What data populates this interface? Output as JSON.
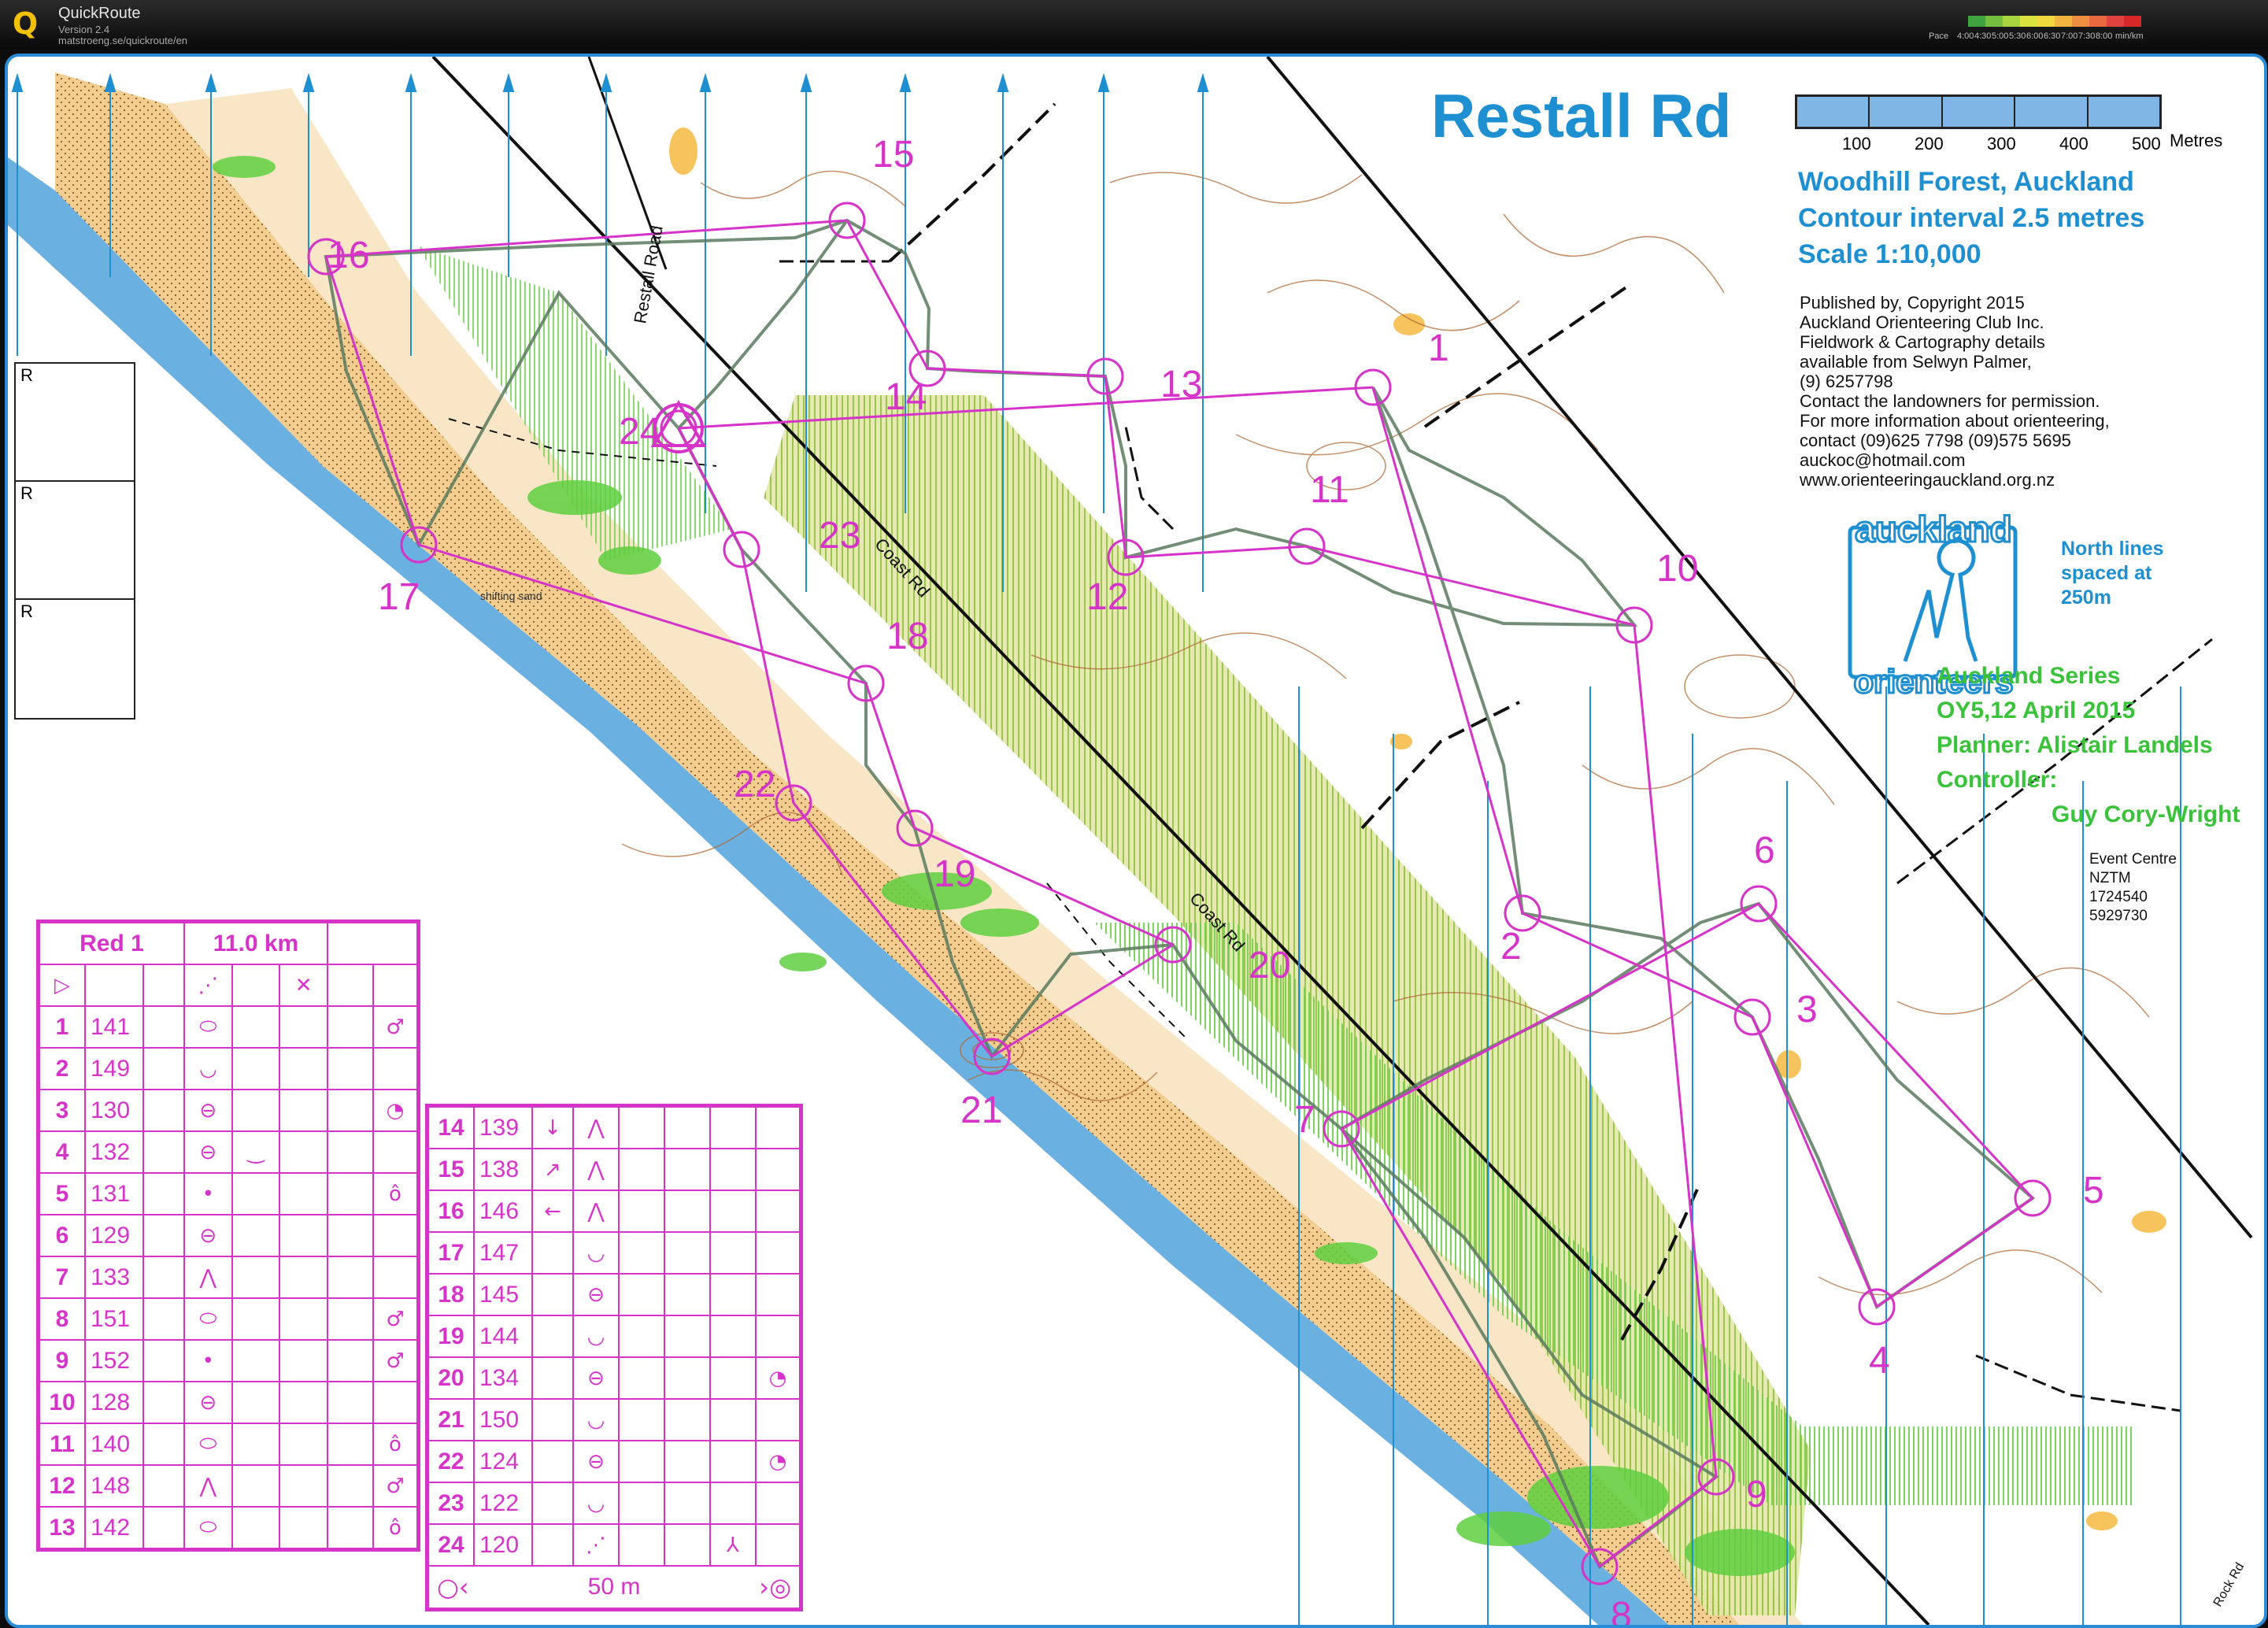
{
  "app": {
    "name": "QuickRoute",
    "version": "Version 2.4",
    "url": "matstroeng.se/quickroute/en",
    "pace_legend": {
      "title": "Pace",
      "unit": "min/km",
      "labels": [
        "4:00",
        "4:30",
        "5:00",
        "5:30",
        "6:00",
        "6:30",
        "7:00",
        "7:30",
        "8:00"
      ],
      "colors": [
        "#3fa33f",
        "#74bf3f",
        "#a7d43f",
        "#d9e23f",
        "#f2d83f",
        "#f2b53f",
        "#ee8f3f",
        "#e8693f",
        "#e0423f",
        "#d62828"
      ]
    }
  },
  "map": {
    "title": "Restall Rd",
    "scale_labels": [
      "100",
      "200",
      "300",
      "400",
      "500"
    ],
    "scale_unit": "Metres",
    "location": "Woodhill Forest, Auckland",
    "contour": "Contour interval 2.5 metres",
    "scale": "Scale 1:10,000",
    "credits": [
      "Published by, Copyright 2015",
      "Auckland Orienteering Club Inc.",
      "Fieldwork & Cartography details",
      "available from Selwyn Palmer,",
      "(9) 6257798",
      "Contact the landowners for permission.",
      "For more information about orienteering,",
      "contact (09)625 7798  (09)575 5695",
      "auckoc@hotmail.com",
      "www.orienteeringauckland.org.nz"
    ],
    "club_logo": [
      "auckland",
      "orienteers"
    ],
    "north_note": [
      "North lines",
      "spaced at",
      "250m"
    ],
    "series": [
      "Auckland Series",
      "OY5,12 April 2015",
      "Planner: Alistair Landels",
      "Controller:",
      "Guy Cory-Wright"
    ],
    "event": [
      "Event Centre",
      "NZTM",
      "1724540",
      "5929730"
    ],
    "road_labels": [
      "Restall Road",
      "Coast Rd",
      "Coast Rd",
      "shifting sand",
      "Rock Rd"
    ],
    "colors": {
      "course": "#d633c8",
      "route": "#5a7a5e",
      "sea": "#6ab0e0",
      "sand": "#f0c98a",
      "contour": "#a0522d",
      "felled": "#c8cf5a",
      "green": "#5fcf3f",
      "north": "#1e8fd0"
    }
  },
  "course": {
    "controls": [
      {
        "n": "1",
        "x": 1734,
        "y": 420
      },
      {
        "n": "2",
        "x": 1924,
        "y": 1088
      },
      {
        "n": "3",
        "x": 2216,
        "y": 1220
      },
      {
        "n": "4",
        "x": 2374,
        "y": 1588
      },
      {
        "n": "5",
        "x": 2572,
        "y": 1450
      },
      {
        "n": "6",
        "x": 2224,
        "y": 1076
      },
      {
        "n": "7",
        "x": 1694,
        "y": 1362
      },
      {
        "n": "8",
        "x": 2022,
        "y": 1918
      },
      {
        "n": "9",
        "x": 2170,
        "y": 1804
      },
      {
        "n": "10",
        "x": 2066,
        "y": 722
      },
      {
        "n": "11",
        "x": 1650,
        "y": 622
      },
      {
        "n": "12",
        "x": 1420,
        "y": 636
      },
      {
        "n": "13",
        "x": 1394,
        "y": 406
      },
      {
        "n": "14",
        "x": 1168,
        "y": 396
      },
      {
        "n": "15",
        "x": 1066,
        "y": 208
      },
      {
        "n": "16",
        "x": 404,
        "y": 254
      },
      {
        "n": "17",
        "x": 522,
        "y": 620
      },
      {
        "n": "18",
        "x": 1090,
        "y": 796
      },
      {
        "n": "19",
        "x": 1152,
        "y": 980
      },
      {
        "n": "20",
        "x": 1480,
        "y": 1128
      },
      {
        "n": "21",
        "x": 1250,
        "y": 1270
      },
      {
        "n": "22",
        "x": 998,
        "y": 948
      },
      {
        "n": "23",
        "x": 932,
        "y": 626
      },
      {
        "n": "24",
        "x": 852,
        "y": 472
      }
    ],
    "labels": [
      {
        "t": "1",
        "x": 1804,
        "y": 386
      },
      {
        "t": "2",
        "x": 1896,
        "y": 1146
      },
      {
        "t": "3",
        "x": 2272,
        "y": 1226
      },
      {
        "t": "4",
        "x": 2364,
        "y": 1672
      },
      {
        "t": "5",
        "x": 2636,
        "y": 1456
      },
      {
        "t": "6",
        "x": 2218,
        "y": 1024
      },
      {
        "t": "7",
        "x": 1634,
        "y": 1366
      },
      {
        "t": "8",
        "x": 2036,
        "y": 1996
      },
      {
        "t": "9",
        "x": 2208,
        "y": 1842
      },
      {
        "t": "10",
        "x": 2094,
        "y": 666
      },
      {
        "t": "11",
        "x": 1654,
        "y": 566
      },
      {
        "t": "12",
        "x": 1370,
        "y": 702
      },
      {
        "t": "13",
        "x": 1464,
        "y": 432
      },
      {
        "t": "14",
        "x": 1114,
        "y": 448
      },
      {
        "t": "15",
        "x": 1098,
        "y": 140
      },
      {
        "t": "16",
        "x": 406,
        "y": 268
      },
      {
        "t": "17",
        "x": 470,
        "y": 702
      },
      {
        "t": "18",
        "x": 1116,
        "y": 752
      },
      {
        "t": "19",
        "x": 1176,
        "y": 1054
      },
      {
        "t": "20",
        "x": 1576,
        "y": 1170
      },
      {
        "t": "21",
        "x": 1210,
        "y": 1354
      },
      {
        "t": "22",
        "x": 922,
        "y": 940
      },
      {
        "t": "23",
        "x": 1030,
        "y": 624
      },
      {
        "t": "24",
        "x": 776,
        "y": 492
      }
    ]
  },
  "description": {
    "course_name": "Red 1",
    "length": "11.0 km",
    "rows_left": [
      {
        "n": "1",
        "code": "141",
        "s3": "⬭",
        "s8": "♂"
      },
      {
        "n": "2",
        "code": "149",
        "s3": "◡",
        "s8": ""
      },
      {
        "n": "3",
        "code": "130",
        "s3": "⊖",
        "s8": "◔"
      },
      {
        "n": "4",
        "code": "132",
        "s3": "⊖",
        "s4": "‿",
        "s8": ""
      },
      {
        "n": "5",
        "code": "131",
        "s3": "•",
        "s8": "ô"
      },
      {
        "n": "6",
        "code": "129",
        "s3": "⊖",
        "s8": ""
      },
      {
        "n": "7",
        "code": "133",
        "s3": "⋀",
        "s8": ""
      },
      {
        "n": "8",
        "code": "151",
        "s3": "⬭",
        "s8": "♂"
      },
      {
        "n": "9",
        "code": "152",
        "s3": "•",
        "s8": "♂"
      },
      {
        "n": "10",
        "code": "128",
        "s3": "⊖",
        "s8": ""
      },
      {
        "n": "11",
        "code": "140",
        "s3": "⬭",
        "s8": "ô"
      },
      {
        "n": "12",
        "code": "148",
        "s3": "⋀",
        "s8": "♂"
      },
      {
        "n": "13",
        "code": "142",
        "s3": "⬭",
        "s8": "ô"
      }
    ],
    "rows_right": [
      {
        "n": "14",
        "code": "139",
        "s2": "↓",
        "s3": "⋀",
        "s8": ""
      },
      {
        "n": "15",
        "code": "138",
        "s2": "↗",
        "s3": "⋀",
        "s8": ""
      },
      {
        "n": "16",
        "code": "146",
        "s2": "←",
        "s3": "⋀",
        "s8": ""
      },
      {
        "n": "17",
        "code": "147",
        "s3": "◡",
        "s8": ""
      },
      {
        "n": "18",
        "code": "145",
        "s3": "⊖",
        "s8": ""
      },
      {
        "n": "19",
        "code": "144",
        "s3": "◡",
        "s8": ""
      },
      {
        "n": "20",
        "code": "134",
        "s3": "⊖",
        "s8": "◔"
      },
      {
        "n": "21",
        "code": "150",
        "s3": "◡",
        "s8": ""
      },
      {
        "n": "22",
        "code": "124",
        "s3": "⊖",
        "s8": "◔"
      },
      {
        "n": "23",
        "code": "122",
        "s3": "◡",
        "s8": ""
      },
      {
        "n": "24",
        "code": "120",
        "s3": "⋰",
        "s7": "⅄",
        "s8": ""
      }
    ],
    "start_row": {
      "s1": "▷",
      "s3": "⋰",
      "s5": "✕"
    },
    "finish_row": {
      "left": "○‹",
      "dist": "50 m",
      "right": "›◎"
    }
  },
  "rboxes": [
    "R",
    "R",
    "R"
  ]
}
